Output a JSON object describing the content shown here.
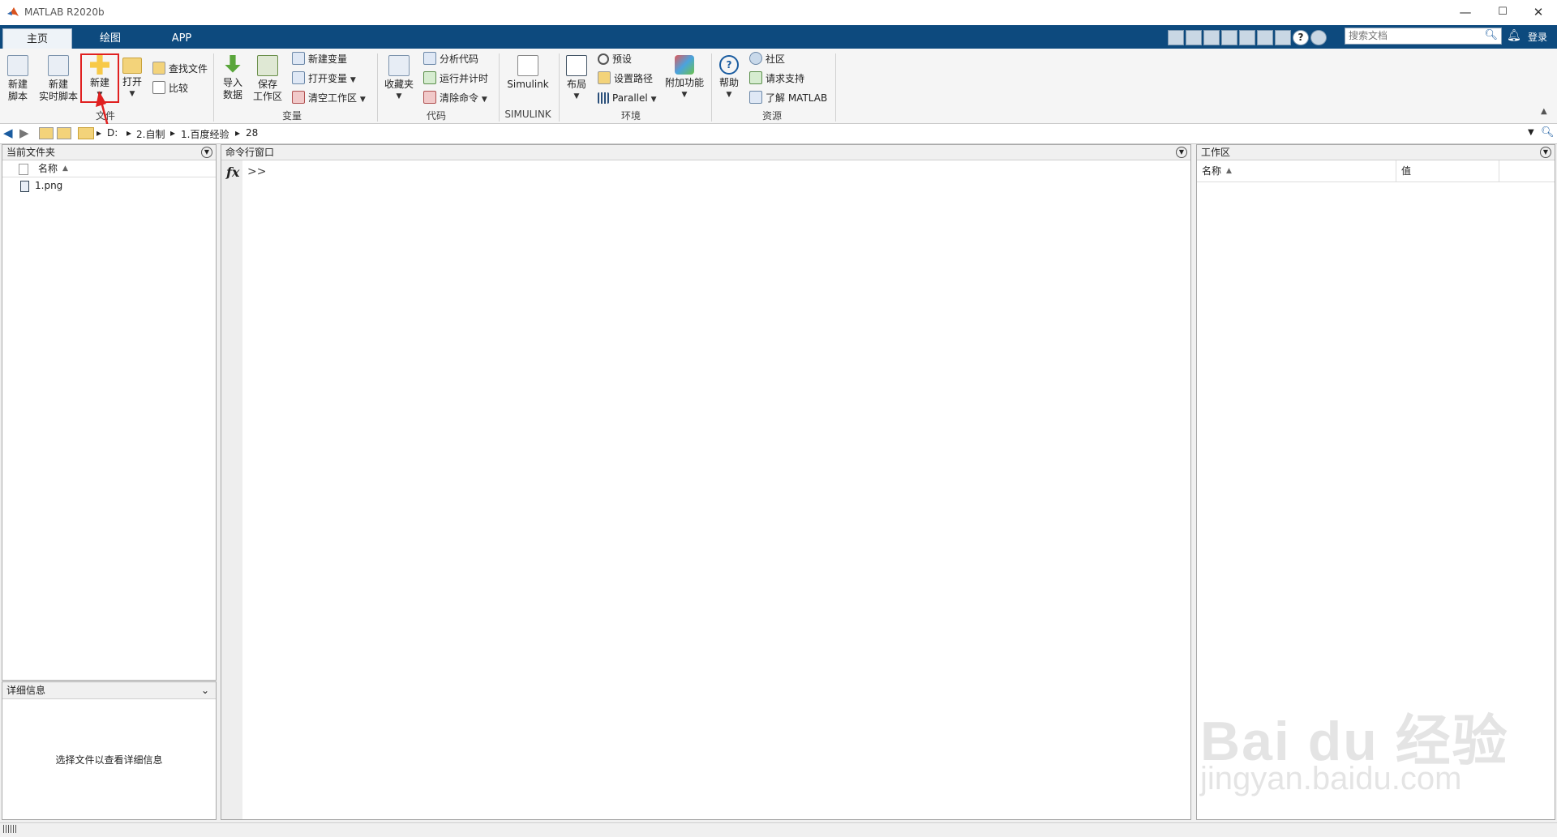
{
  "window": {
    "title": "MATLAB R2020b",
    "minimize": "—",
    "maximize": "☐",
    "close": "✕"
  },
  "tabs": [
    {
      "label": "主页"
    },
    {
      "label": "绘图"
    },
    {
      "label": "APP"
    }
  ],
  "search": {
    "placeholder": "搜索文档"
  },
  "login": "登录",
  "ribbon": {
    "file": {
      "group_label": "文件",
      "new_script": "新建\n脚本",
      "new_live_script": "新建\n实时脚本",
      "new": "新建",
      "open": "打开",
      "find_files": "查找文件",
      "compare": "比较"
    },
    "variable": {
      "group_label": "变量",
      "import_data": "导入\n数据",
      "save_workspace": "保存\n工作区",
      "new_variable": "新建变量",
      "open_variable": "打开变量",
      "clear_workspace": "清空工作区"
    },
    "code": {
      "group_label": "代码",
      "favorites": "收藏夹",
      "analyze_code": "分析代码",
      "run_and_time": "运行并计时",
      "clear_commands": "清除命令"
    },
    "simulink": {
      "group_label": "SIMULINK",
      "simulink": "Simulink"
    },
    "environment": {
      "group_label": "环境",
      "layout": "布局",
      "preferences": "预设",
      "set_path": "设置路径",
      "parallel": "Parallel",
      "add_ons": "附加功能"
    },
    "resources": {
      "group_label": "资源",
      "help": "帮助",
      "community": "社区",
      "request_support": "请求支持",
      "learn_matlab": "了解 MATLAB"
    }
  },
  "address": {
    "crumbs": [
      "D:",
      "2.自制",
      "1.百度经验",
      "28"
    ]
  },
  "current_folder": {
    "title": "当前文件夹",
    "column_name": "名称",
    "files": [
      {
        "name": "1.png"
      }
    ]
  },
  "details": {
    "title": "详细信息",
    "message": "选择文件以查看详细信息"
  },
  "command_window": {
    "title": "命令行窗口",
    "fx": "fx",
    "prompt": ">>"
  },
  "workspace": {
    "title": "工作区",
    "column_name": "名称",
    "column_value": "值"
  },
  "watermark": {
    "brand": "Bai du 经验",
    "url": "jingyan.baidu.com"
  },
  "colors": {
    "tab_bar": "#0d4a7e",
    "annotation": "#e02020"
  }
}
